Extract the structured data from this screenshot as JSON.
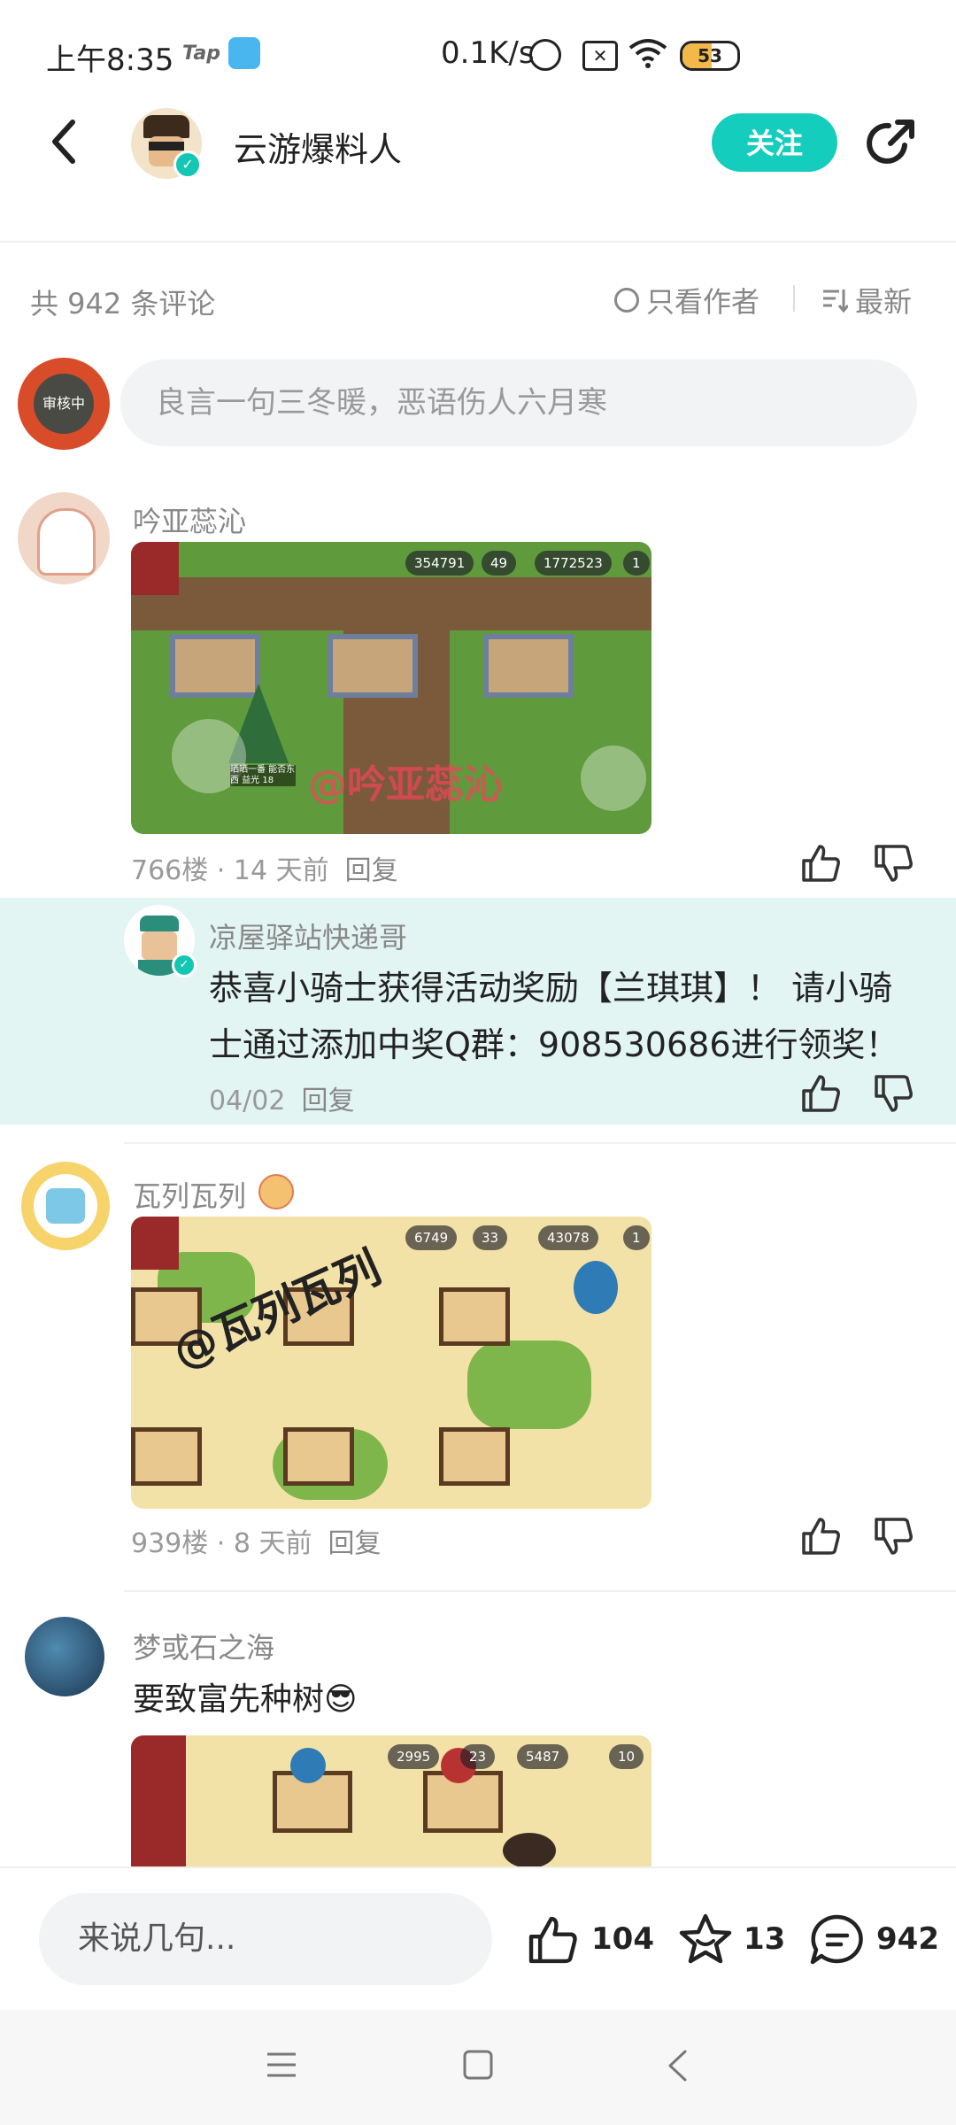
{
  "status_bar": {
    "time": "上午8:35",
    "tap_label": "Tap",
    "net_speed": "0.1K/s",
    "battery": "53",
    "battery_level": 0.53
  },
  "header": {
    "title": "云游爆料人",
    "follow_label": "关注"
  },
  "toolbar": {
    "count_text": "共 942 条评论",
    "only_author_label": "只看作者",
    "sort_label": "最新"
  },
  "comment_input": {
    "placeholder": "良言一句三冬暖，恶语伤人六月寒",
    "avatar_text": "审核中"
  },
  "comments": [
    {
      "name": "吟亚蕊沁",
      "meta": "766楼 · 14 天前",
      "reply_label": "回复",
      "image": {
        "hud": [
          "354791",
          "49",
          "1772523",
          "1"
        ],
        "watermark": "@吟亚蕊沁",
        "tree_label": "晒晒一番 能否东西 益光 18"
      }
    },
    {
      "name": "瓦列瓦列",
      "meta": "939楼 · 8 天前",
      "reply_label": "回复",
      "image": {
        "hud": [
          "6749",
          "33",
          "43078",
          "1"
        ],
        "watermark": "@瓦列瓦列"
      }
    },
    {
      "name": "梦或石之海",
      "text": "要致富先种树😎",
      "image": {
        "hud": [
          "2995",
          "23",
          "5487",
          "10"
        ]
      }
    }
  ],
  "reply": {
    "name": "凉屋驿站快递哥",
    "text": "恭喜小骑士获得活动奖励【兰琪琪】！ 请小骑士通过添加中奖Q群：908530686进行领奖！",
    "date": "04/02",
    "reply_label": "回复"
  },
  "bottom_bar": {
    "input_placeholder": "来说几句...",
    "likes": "104",
    "favorites": "13",
    "comments": "942"
  },
  "colors": {
    "accent": "#15cdbd",
    "reply_bg": "#e2f5f3"
  }
}
